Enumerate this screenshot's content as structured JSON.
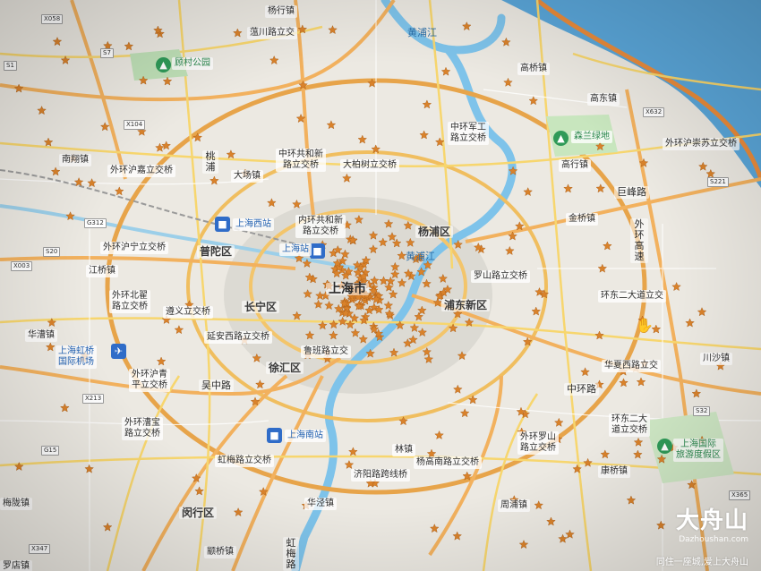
{
  "map": {
    "colors": {
      "land": "#ece9e2",
      "sea": "#5aa6d9",
      "river": "#7ec3ea",
      "highway": "#f2b15e",
      "main_road": "#f7d66e",
      "ring_road": "#e7a44a",
      "marker": "#d9822b"
    },
    "district_labels": [
      "普陀区",
      "长宁区",
      "徐汇区",
      "杨浦区",
      "浦东新区",
      "闵行区",
      "上海市"
    ],
    "interchange_labels": [
      "蕰川路立交",
      "中环军工\n路立交桥",
      "中环共和新\n路立交桥",
      "大柏树立交桥",
      "外环沪嘉立交桥",
      "内环共和新\n路立交桥",
      "外环沪宁立交桥",
      "外环北翟\n路立交桥",
      "遵义立交桥",
      "延安西路立交桥",
      "外环沪青\n平立交桥",
      "外环漕宝\n路立交桥",
      "虹梅路立交桥",
      "鲁班路立交",
      "罗山路立交桥",
      "环东二大道立交",
      "华夏西路立交",
      "环东二大\n道立交桥",
      "外环罗山\n路立交桥",
      "杨高南路立交桥",
      "济阳路跨线桥",
      "外环沪崇苏立交桥"
    ],
    "place_labels": [
      "杨行镇",
      "高桥镇",
      "高东镇",
      "高行镇",
      "南翔镇",
      "大场镇",
      "江桥镇",
      "华漕镇",
      "金桥镇",
      "川沙镇",
      "康桥镇",
      "周浦镇",
      "华泾镇",
      "颛桥镇",
      "梅陇镇",
      "林镇",
      "罗店镇",
      "顾村公园",
      "森兰绿地"
    ],
    "road_labels": [
      "外环高速",
      "巨峰路",
      "中环路",
      "吴中路",
      "桃浦",
      "虹梅路",
      "黄浦江",
      "黄浦江"
    ],
    "stations": [
      "上海西站",
      "上海站",
      "上海南站"
    ],
    "airports": [
      "上海虹桥\n国际机场"
    ],
    "parks": [
      "上海国际\n旅游度假区"
    ],
    "road_badges": [
      "X058",
      "S7",
      "X104",
      "G312",
      "X003",
      "S20",
      "X213",
      "G15",
      "X632",
      "S221",
      "S1",
      "X365",
      "X347",
      "S32"
    ],
    "watermark": {
      "brand": "大舟山",
      "url": "Dazhoushan.com",
      "slogan": "同住一座城,爱上大舟山"
    }
  }
}
